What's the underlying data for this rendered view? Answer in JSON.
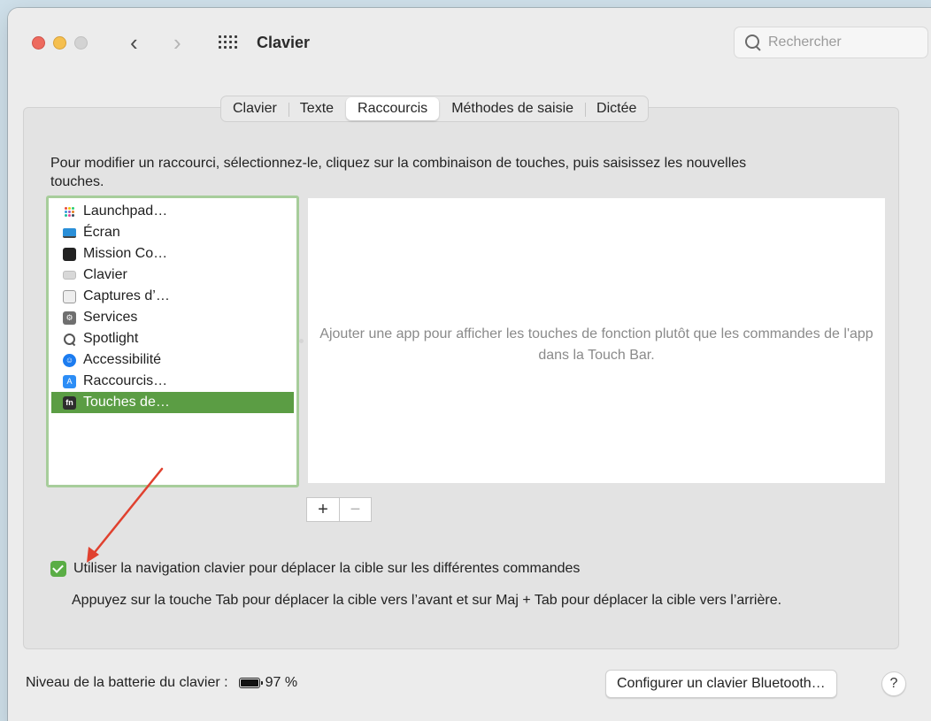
{
  "window": {
    "title": "Clavier"
  },
  "toolbar": {
    "back_icon": "chevron-left",
    "forward_icon": "chevron-right",
    "grid_icon": "show-all-grid",
    "search_placeholder": "Rechercher"
  },
  "tabs": [
    {
      "label": "Clavier"
    },
    {
      "label": "Texte"
    },
    {
      "label": "Raccourcis"
    },
    {
      "label": "Méthodes de saisie"
    },
    {
      "label": "Dictée"
    }
  ],
  "active_tab": "Raccourcis",
  "instructions": "Pour modifier un raccourci, sélectionnez-le, cliquez sur la combinaison de touches, puis saisissez les nouvelles touches.",
  "categories": [
    {
      "label": "Launchpad…",
      "icon": "launchpad-icon"
    },
    {
      "label": "Écran",
      "icon": "display-icon"
    },
    {
      "label": "Mission Co…",
      "icon": "mission-control-icon"
    },
    {
      "label": "Clavier",
      "icon": "keyboard-icon"
    },
    {
      "label": "Captures d’…",
      "icon": "screenshot-icon"
    },
    {
      "label": "Services",
      "icon": "services-icon"
    },
    {
      "label": "Spotlight",
      "icon": "spotlight-icon"
    },
    {
      "label": "Accessibilité",
      "icon": "accessibility-icon"
    },
    {
      "label": "Raccourcis…",
      "icon": "app-store-icon"
    },
    {
      "label": "Touches de…",
      "icon": "fn-key-icon"
    }
  ],
  "selected_category": "Touches de…",
  "app_area": {
    "hint": "Ajouter une app pour afficher les touches de fonction plutôt que les commandes de l'app dans la Touch Bar."
  },
  "buttons": {
    "add": "+",
    "remove": "−"
  },
  "keyboard_navigation": {
    "checked": true,
    "label": "Utiliser la navigation clavier pour déplacer la cible sur les différentes commandes",
    "description": "Appuyez sur la touche Tab pour déplacer la cible vers l’avant et sur Maj + Tab pour déplacer la cible vers l’arrière."
  },
  "footer": {
    "battery_label": "Niveau de la batterie du clavier :",
    "battery_value": "97 %",
    "bluetooth_button": "Configurer un clavier Bluetooth…",
    "help": "?"
  },
  "colors": {
    "selection": "#5b9d44",
    "focus_ring": "#a7cd9b",
    "checkbox": "#5aad45",
    "annotation_arrow": "#e0412f"
  }
}
